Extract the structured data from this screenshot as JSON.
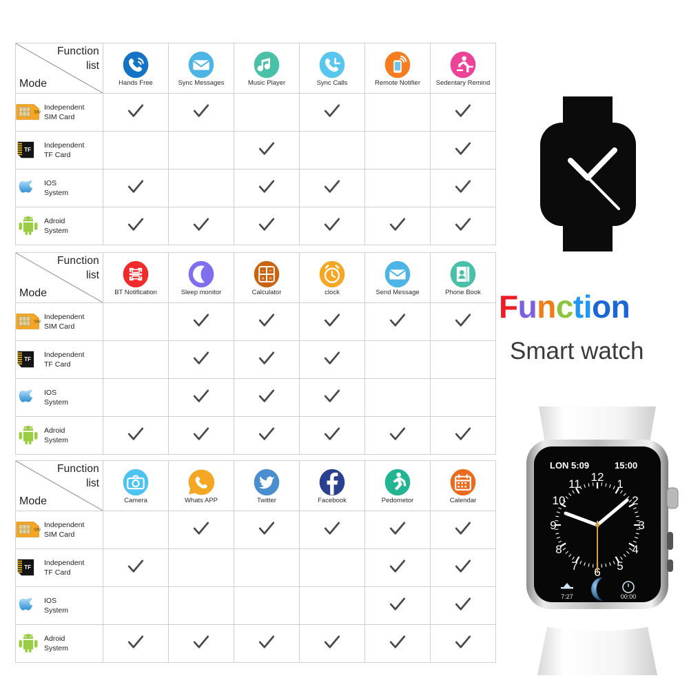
{
  "header": {
    "function_label": "Function",
    "list_label": "list",
    "mode_label": "Mode"
  },
  "modes": [
    {
      "line1": "Independent",
      "line2": "SIM  Card",
      "icon": "sim-card-icon"
    },
    {
      "line1": "Independent",
      "line2": "TF  Card",
      "icon": "tf-card-icon"
    },
    {
      "line1": "IOS",
      "line2": "System",
      "icon": "apple-icon"
    },
    {
      "line1": "Adroid",
      "line2": "System",
      "icon": "android-icon"
    }
  ],
  "tables": [
    {
      "id": "table-1",
      "columns": [
        {
          "label": "Hands Free",
          "icon": "phone-call-icon",
          "color": "#1573c6"
        },
        {
          "label": "Sync Messages",
          "icon": "envelope-icon",
          "color": "#4cb5e6"
        },
        {
          "label": "Music Player",
          "icon": "music-note-icon",
          "color": "#4bc0a8"
        },
        {
          "label": "Sync Calls",
          "icon": "phone-sync-icon",
          "color": "#59c6ee"
        },
        {
          "label": "Remote Notifier",
          "icon": "remote-phone-icon",
          "color": "#f57d20"
        },
        {
          "label": "Sedentary Remind",
          "icon": "sedentary-icon",
          "color": "#ec4398"
        }
      ],
      "rows": [
        {
          "mode": 0,
          "checks": [
            true,
            true,
            false,
            true,
            false,
            true
          ]
        },
        {
          "mode": 1,
          "checks": [
            false,
            false,
            true,
            false,
            false,
            true
          ]
        },
        {
          "mode": 2,
          "checks": [
            true,
            false,
            true,
            true,
            false,
            true
          ]
        },
        {
          "mode": 3,
          "checks": [
            true,
            true,
            true,
            true,
            true,
            true
          ]
        }
      ]
    },
    {
      "id": "table-2",
      "columns": [
        {
          "label": "BT Notification",
          "icon": "bt-scan-icon",
          "color": "#ef2b2b"
        },
        {
          "label": "Sleep monitor",
          "icon": "moon-icon",
          "color": "#7e6ef0"
        },
        {
          "label": "Calculator",
          "icon": "calculator-icon",
          "color": "#c9630f"
        },
        {
          "label": "clock",
          "icon": "alarm-clock-icon",
          "color": "#f5a623"
        },
        {
          "label": "Send Message",
          "icon": "envelope-icon",
          "color": "#4cb5e6"
        },
        {
          "label": "Phone Book",
          "icon": "contact-book-icon",
          "color": "#4bc0a8"
        }
      ],
      "rows": [
        {
          "mode": 0,
          "checks": [
            false,
            true,
            true,
            true,
            true,
            true
          ]
        },
        {
          "mode": 1,
          "checks": [
            false,
            true,
            true,
            true,
            false,
            false
          ]
        },
        {
          "mode": 2,
          "checks": [
            false,
            true,
            true,
            true,
            false,
            false
          ]
        },
        {
          "mode": 3,
          "checks": [
            true,
            true,
            true,
            true,
            true,
            true
          ]
        }
      ]
    },
    {
      "id": "table-3",
      "columns": [
        {
          "label": "Camera",
          "icon": "camera-icon",
          "color": "#4cc3f0"
        },
        {
          "label": "Whats APP",
          "icon": "whatsapp-icon",
          "color": "#f5a623"
        },
        {
          "label": "Twitter",
          "icon": "twitter-icon",
          "color": "#4a8ed0"
        },
        {
          "label": "Facebook",
          "icon": "facebook-icon",
          "color": "#2b3f8f"
        },
        {
          "label": "Pedometor",
          "icon": "pedometer-icon",
          "color": "#22b592"
        },
        {
          "label": "Calendar",
          "icon": "calendar-icon",
          "color": "#ea6a1e"
        }
      ],
      "rows": [
        {
          "mode": 0,
          "checks": [
            false,
            true,
            true,
            true,
            true,
            true
          ]
        },
        {
          "mode": 1,
          "checks": [
            true,
            false,
            false,
            false,
            true,
            true
          ]
        },
        {
          "mode": 2,
          "checks": [
            false,
            false,
            false,
            false,
            true,
            true
          ]
        },
        {
          "mode": 3,
          "checks": [
            true,
            true,
            true,
            true,
            true,
            true
          ]
        }
      ]
    }
  ],
  "branding": {
    "title_letters": [
      {
        "ch": "F",
        "color": "#ee1c25"
      },
      {
        "ch": "u",
        "color": "#7d5fe0"
      },
      {
        "ch": "n",
        "color": "#f07c18"
      },
      {
        "ch": "c",
        "color": "#8cc63e"
      },
      {
        "ch": "t",
        "color": "#2196f3"
      },
      {
        "ch": "i",
        "color": "#2196f3"
      },
      {
        "ch": "o",
        "color": "#1a66d6"
      },
      {
        "ch": "n",
        "color": "#1a66d6"
      }
    ],
    "title_text": "Function",
    "subtitle": "Smart watch"
  },
  "watch_photo": {
    "status_left": "LON 5:09",
    "status_right": "15:00",
    "hour_numerals": [
      "12",
      "1",
      "2",
      "3",
      "4",
      "5",
      "6",
      "7",
      "8",
      "9",
      "10",
      "11"
    ],
    "shortcut_left_label": "7:27",
    "shortcut_left_icon": "pedometer-icon",
    "shortcut_center_icon": "moon-icon",
    "shortcut_right_label": "00:00",
    "shortcut_right_icon": "alarm-icon"
  },
  "watch_silhouette": {
    "icon": "smartwatch-icon"
  },
  "colors": {
    "grid_line": "#cfcfcf",
    "check_mark": "#4a4a4a",
    "text": "#222222"
  }
}
